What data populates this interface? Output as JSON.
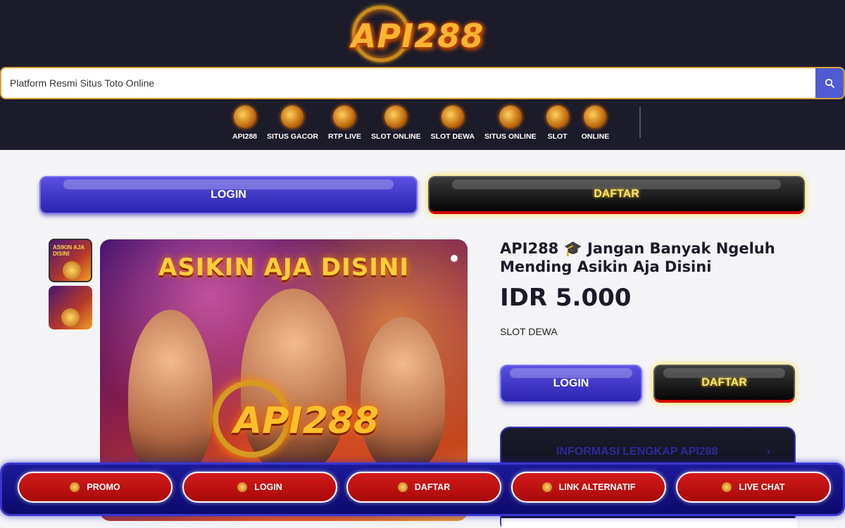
{
  "brand": {
    "logo_text": "API288"
  },
  "search": {
    "placeholder": "Platform Resmi Situs Toto Online"
  },
  "nav": [
    {
      "label": "API288"
    },
    {
      "label": "SITUS GACOR"
    },
    {
      "label": "RTP LIVE"
    },
    {
      "label": "SLOT ONLINE"
    },
    {
      "label": "SLOT DEWA"
    },
    {
      "label": "SITUS ONLINE"
    },
    {
      "label": "SLOT"
    },
    {
      "label": "ONLINE"
    }
  ],
  "top_buttons": {
    "login": "LOGIN",
    "daftar": "DAFTAR"
  },
  "hero": {
    "banner_text": "ASIKIN AJA DISINI",
    "logo_text": "API288"
  },
  "thumbs": [
    {
      "text": "ASIKIN AJA DISINI"
    },
    {
      "text": ""
    }
  ],
  "product": {
    "title": "API288 🎓 Jangan Banyak Ngeluh Mending Asikin Aja Disini",
    "price": "IDR 5.000",
    "category": "SLOT DEWA",
    "login_label": "LOGIN",
    "daftar_label": "DAFTAR",
    "info_label": "INFORMASI LENGKAP API288",
    "info_chevron": "›"
  },
  "bottom_bar": [
    {
      "label": "PROMO"
    },
    {
      "label": "LOGIN"
    },
    {
      "label": "DAFTAR"
    },
    {
      "label": "LINK ALTERNATIF"
    },
    {
      "label": "LIVE CHAT"
    }
  ],
  "colors": {
    "header_bg": "#1c1b29",
    "login_blue": "#3a30c8",
    "daftar_black": "#0a0a0a",
    "bottom_red": "#c01010",
    "search_btn": "#4f5bd5"
  }
}
